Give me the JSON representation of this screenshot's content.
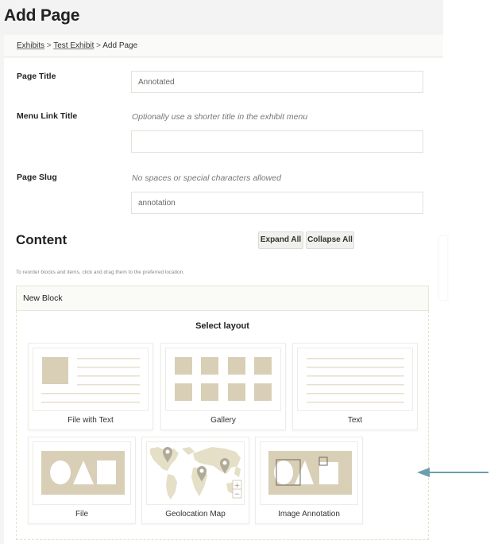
{
  "header": {
    "title": "Add Page"
  },
  "breadcrumb": {
    "items": [
      {
        "label": "Exhibits",
        "link": true
      },
      {
        "label": "Test Exhibit",
        "link": true
      },
      {
        "label": "Add Page",
        "link": false
      }
    ],
    "separator": ">"
  },
  "form": {
    "page_title": {
      "label": "Page Title",
      "value": "Annotated"
    },
    "menu_link_title": {
      "label": "Menu Link Title",
      "hint": "Optionally use a shorter title in the exhibit menu",
      "value": ""
    },
    "page_slug": {
      "label": "Page Slug",
      "hint": "No spaces or special characters allowed",
      "value": "annotation"
    }
  },
  "content": {
    "title": "Content",
    "expand_all_label": "Expand All",
    "collapse_all_label": "Collapse All",
    "reorder_hint": "To reorder blocks and items, click and drag them to the preferred location.",
    "block": {
      "title": "New Block",
      "select_layout_label": "Select layout",
      "layouts": [
        {
          "label": "File with Text",
          "icon": "file-with-text-layout-icon"
        },
        {
          "label": "Gallery",
          "icon": "gallery-layout-icon"
        },
        {
          "label": "Text",
          "icon": "text-layout-icon"
        },
        {
          "label": "File",
          "icon": "file-layout-icon"
        },
        {
          "label": "Geolocation Map",
          "icon": "geolocation-map-layout-icon"
        },
        {
          "label": "Image Annotation",
          "icon": "image-annotation-layout-icon"
        }
      ]
    }
  },
  "colors": {
    "thumb_fill": "#d8cfb6",
    "thumb_line": "#e6dfcc",
    "map_fill": "#e4dfc6",
    "pin": "#b0ab98",
    "arrow": "#6a9fae"
  }
}
